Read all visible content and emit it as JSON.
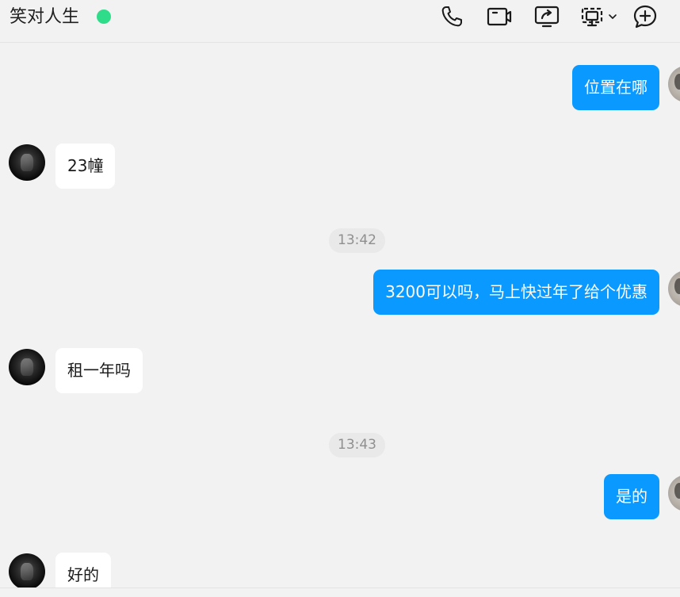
{
  "header": {
    "contact_name": "笑对人生",
    "status_color": "#2fdc8a",
    "tools": [
      {
        "icon": "phone-icon"
      },
      {
        "icon": "video-camera-icon"
      },
      {
        "icon": "screen-share-icon"
      },
      {
        "icon": "remote-desktop-icon"
      },
      {
        "icon": "add-chat-icon"
      }
    ]
  },
  "messages": [
    {
      "side": "out",
      "text": "位置在哪"
    },
    {
      "side": "in",
      "text": "23幢"
    },
    {
      "type": "time",
      "text": "13:42"
    },
    {
      "side": "out",
      "text": "3200可以吗，马上快过年了给个优惠"
    },
    {
      "side": "in",
      "text": "租一年吗"
    },
    {
      "type": "time",
      "text": "13:43"
    },
    {
      "side": "out",
      "text": "是的"
    },
    {
      "side": "in",
      "text": "好的"
    }
  ],
  "colors": {
    "outgoing_bubble": "#0a99ff",
    "incoming_bubble": "#ffffff",
    "background": "#f2f2f2"
  }
}
